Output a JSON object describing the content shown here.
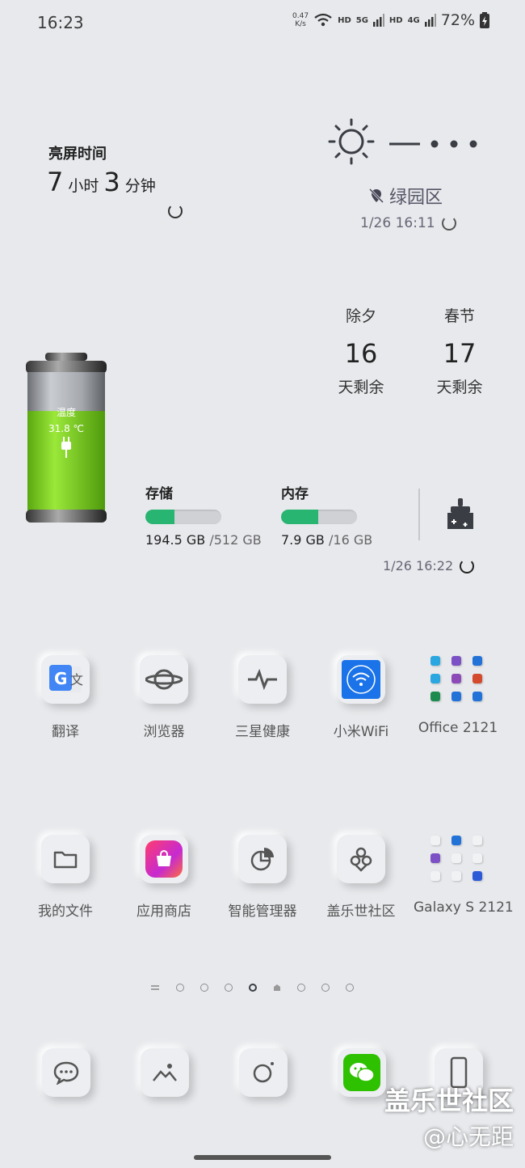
{
  "status": {
    "time": "16:23",
    "net_speed_top": "0.47",
    "net_speed_unit": "K/s",
    "hd1": "HD",
    "sig1": "5G",
    "hd2": "HD",
    "sig2": "4G",
    "battery": "72%"
  },
  "screen_time": {
    "title": "亮屏时间",
    "hours": "7",
    "hours_unit": "小时",
    "minutes": "3",
    "minutes_unit": "分钟"
  },
  "weather": {
    "location": "绿园区",
    "updated": "1/26 16:11"
  },
  "countdown": [
    {
      "name": "除夕",
      "days": "16",
      "suffix": "天剩余"
    },
    {
      "name": "春节",
      "days": "17",
      "suffix": "天剩余"
    }
  ],
  "battery": {
    "temp_label": "温度",
    "temp": "31.8 ℃",
    "fill_percent": 72,
    "fill_color": "#7ed321"
  },
  "storage": {
    "title": "存储",
    "used": "194.5 GB",
    "total": "/512 GB",
    "fraction": 0.38
  },
  "memory": {
    "title": "内存",
    "used": "7.9 GB",
    "total": "/16 GB",
    "fraction": 0.49
  },
  "mem_updated": "1/26 16:22",
  "apps_row1": [
    {
      "label": "翻译",
      "icon": "translate-icon"
    },
    {
      "label": "浏览器",
      "icon": "browser-icon"
    },
    {
      "label": "三星健康",
      "icon": "health-icon"
    },
    {
      "label": "小米WiFi",
      "icon": "wifi-icon"
    },
    {
      "label": "Office 2121",
      "icon": "folder-icon"
    }
  ],
  "apps_row2": [
    {
      "label": "我的文件",
      "icon": "files-icon"
    },
    {
      "label": "应用商店",
      "icon": "store-icon"
    },
    {
      "label": "智能管理器",
      "icon": "manager-icon"
    },
    {
      "label": "盖乐世社区",
      "icon": "community-icon"
    },
    {
      "label": "Galaxy S 2121",
      "icon": "folder-icon"
    }
  ],
  "dock": [
    "messages-icon",
    "gallery-icon",
    "camera-icon",
    "wechat-icon",
    "phone-icon"
  ],
  "watermark": {
    "line1": "盖乐世社区",
    "line2": "@心无距"
  },
  "colors": {
    "accent_green": "#27b571",
    "battery_green": "#7ed321",
    "wifi_blue": "#1a73e8"
  }
}
